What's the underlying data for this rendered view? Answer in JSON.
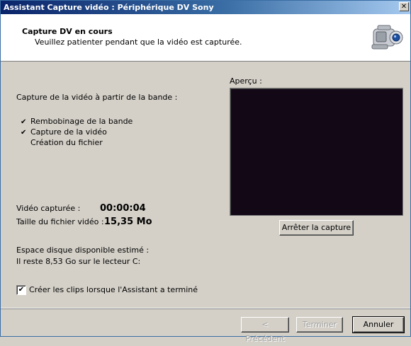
{
  "window": {
    "title": "Assistant Capture vidéo : Périphérique DV Sony",
    "close_label": "✕"
  },
  "header": {
    "title": "Capture DV en cours",
    "subtitle": "Veuillez patienter pendant que la vidéo est capturée.",
    "icon": "camcorder-icon"
  },
  "capture": {
    "section_label": "Capture de la vidéo à partir de la bande :",
    "steps": [
      {
        "label": "Rembobinage de la bande",
        "done": true
      },
      {
        "label": "Capture de la vidéo",
        "done": true
      },
      {
        "label": "Création du fichier",
        "done": false
      }
    ],
    "check_glyph": "✔"
  },
  "stats": {
    "captured_label": "Vidéo capturée :",
    "captured_value": "00:00:04",
    "filesize_label": "Taille du fichier vidéo :",
    "filesize_value": "15,35 Mo",
    "disk_label": "Espace disque disponible estimé :",
    "disk_value": "Il reste 8,53 Go sur le lecteur C:"
  },
  "preview": {
    "label": "Aperçu :",
    "stop_button": "Arrêter la capture"
  },
  "options": {
    "create_clips_label": "Créer les clips lorsque l'Assistant a terminé",
    "create_clips_checked": true,
    "check_glyph": "✔"
  },
  "footer": {
    "back_label": "< Précédent",
    "finish_label": "Terminer",
    "cancel_label": "Annuler"
  }
}
